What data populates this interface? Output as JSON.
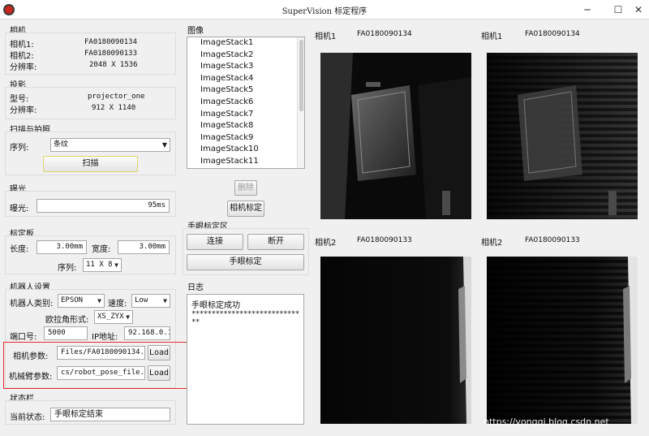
{
  "window": {
    "title": "SuperVision 标定程序",
    "minimize_glyph": "─",
    "maximize_glyph": "☐",
    "close_glyph": "✕"
  },
  "camera": {
    "title": "相机",
    "cam1_label": "相机1:",
    "cam1_value": "FA0180090134",
    "cam2_label": "相机2:",
    "cam2_value": "FA0180090133",
    "res_label": "分辨率:",
    "res_value": "2048 X 1536"
  },
  "projector": {
    "title": "投影",
    "model_label": "型号:",
    "model_value": "projector_one",
    "res_label": "分辨率:",
    "res_value": "912 X 1140"
  },
  "scan": {
    "title": "扫描与拍照",
    "sequence_label": "序列:",
    "sequence_value": "条纹",
    "scan_button": "扫描"
  },
  "exposure": {
    "title": "曝光",
    "label": "曝光:",
    "value": "95ms"
  },
  "board": {
    "title": "标定板",
    "length_label": "长度:",
    "length_value": "3.00mm",
    "width_label": "宽度:",
    "width_value": "3.00mm",
    "sequence_label": "序列:",
    "sequence_value": "11 X 8"
  },
  "robot": {
    "title": "机器人设置",
    "type_label": "机器人类别:",
    "type_value": "EPSON",
    "speed_label": "速度:",
    "speed_value": "Low",
    "euler_label": "欧拉角形式:",
    "euler_value": "XS_ZYX",
    "port_label": "端口号:",
    "port_value": "5000",
    "ip_label": "IP地址:",
    "ip_value": "92.168.0.1",
    "cam_param_label": "相机参数:",
    "cam_param_value": "Files/FA0180090134.xml",
    "arm_param_label": "机械臂参数:",
    "arm_param_value": "cs/robot_pose_file.txt",
    "load_button": "Load"
  },
  "status": {
    "title": "状态栏",
    "label": "当前状态:",
    "value": "手眼标定结束"
  },
  "images": {
    "title": "图像",
    "items": [
      "ImageStack1",
      "ImageStack2",
      "ImageStack3",
      "ImageStack4",
      "ImageStack5",
      "ImageStack6",
      "ImageStack7",
      "ImageStack8",
      "ImageStack9",
      "ImageStack10",
      "ImageStack11"
    ],
    "delete_button": "删除",
    "calibrate_button": "相机标定"
  },
  "handeye": {
    "title": "手眼标定区",
    "connect_button": "连接",
    "disconnect_button": "断开",
    "calibrate_button": "手眼标定"
  },
  "log": {
    "title": "日志",
    "line1": "手眼标定成功",
    "line2": "*****************************"
  },
  "views": [
    {
      "label": "相机1",
      "serial": "FA0180090134"
    },
    {
      "label": "相机1",
      "serial": "FA0180090134"
    },
    {
      "label": "相机2",
      "serial": "FA0180090133"
    },
    {
      "label": "相机2",
      "serial": "FA0180090133"
    }
  ],
  "watermark": "https://yongqi.blog.csdn.net",
  "colors": {
    "highlight_border": "#e8292f",
    "background": "#f0f0f0"
  }
}
